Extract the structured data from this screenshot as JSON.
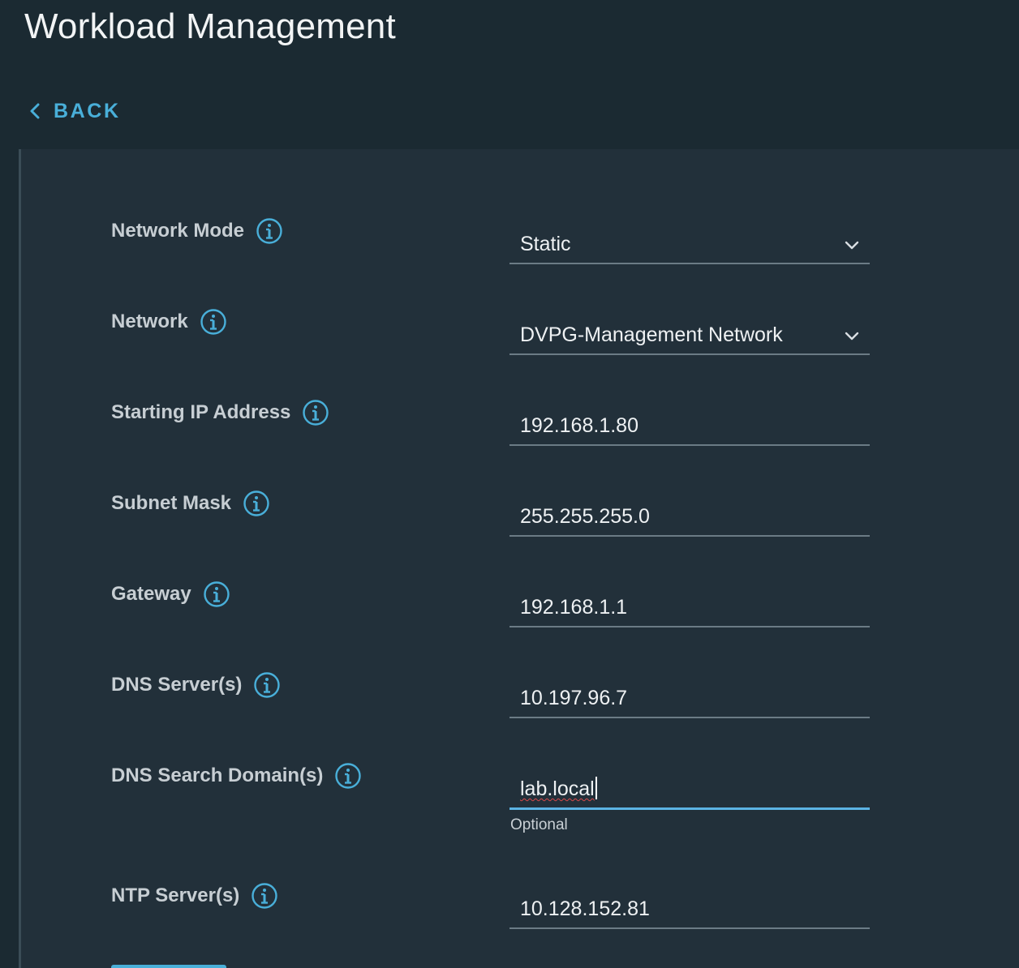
{
  "header": {
    "title": "Workload Management",
    "back_label": "BACK"
  },
  "colors": {
    "page_bg": "#1b2a32",
    "panel_bg": "#22303a",
    "accent": "#49afd9",
    "label_text": "#c7ced3",
    "field_underline": "#6b7b85"
  },
  "form": {
    "network_mode": {
      "label": "Network Mode",
      "value": "Static",
      "icon": "info-icon"
    },
    "network": {
      "label": "Network",
      "value": "DVPG-Management Network",
      "icon": "info-icon"
    },
    "starting_ip": {
      "label": "Starting IP Address",
      "value": "192.168.1.80",
      "icon": "info-icon"
    },
    "subnet_mask": {
      "label": "Subnet Mask",
      "value": "255.255.255.0",
      "icon": "info-icon"
    },
    "gateway": {
      "label": "Gateway",
      "value": "192.168.1.1",
      "icon": "info-icon"
    },
    "dns_servers": {
      "label": "DNS Server(s)",
      "value": "10.197.96.7",
      "icon": "info-icon"
    },
    "dns_search_domains": {
      "label": "DNS Search Domain(s)",
      "value": "lab.local",
      "helper": "Optional",
      "icon": "info-icon"
    },
    "ntp_servers": {
      "label": "NTP Server(s)",
      "value": "10.128.152.81",
      "icon": "info-icon"
    }
  }
}
